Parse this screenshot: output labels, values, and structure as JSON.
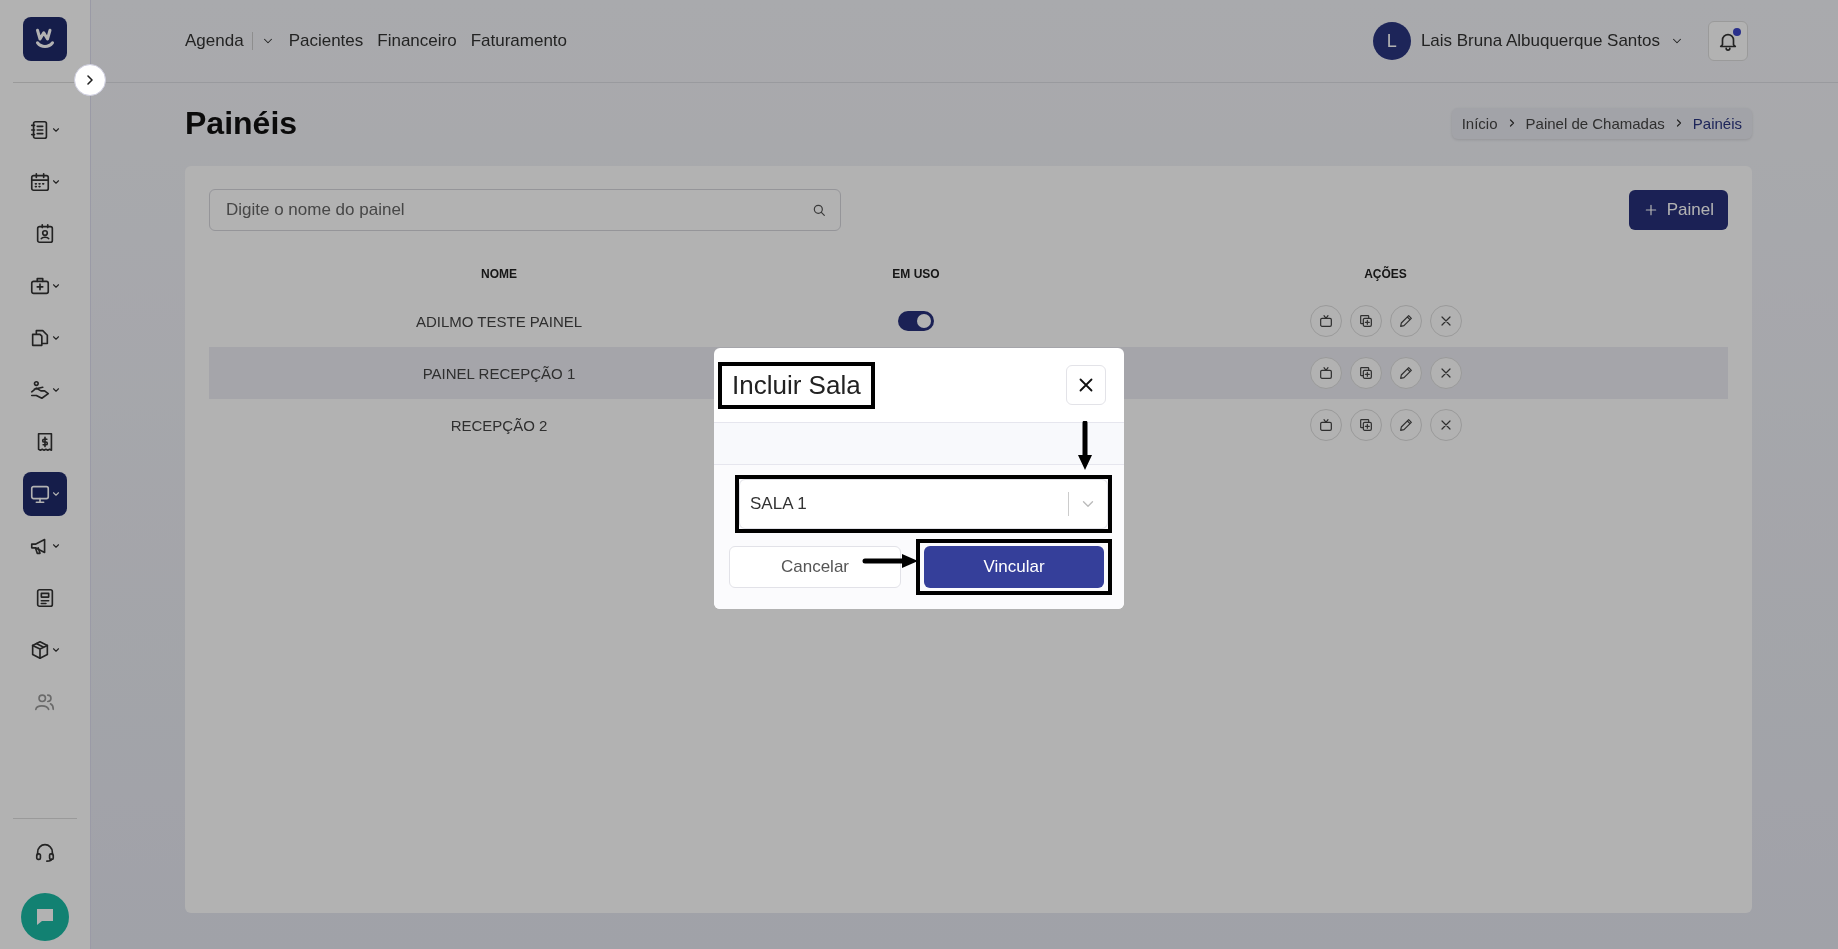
{
  "sidebar": {
    "items": [
      {
        "expandable": true,
        "selected": false,
        "disabled": false
      },
      {
        "expandable": true,
        "selected": false,
        "disabled": false
      },
      {
        "expandable": false,
        "selected": false,
        "disabled": false
      },
      {
        "expandable": true,
        "selected": false,
        "disabled": false
      },
      {
        "expandable": true,
        "selected": false,
        "disabled": false
      },
      {
        "expandable": true,
        "selected": false,
        "disabled": false
      },
      {
        "expandable": false,
        "selected": false,
        "disabled": false
      },
      {
        "expandable": true,
        "selected": true,
        "disabled": false
      },
      {
        "expandable": true,
        "selected": false,
        "disabled": false
      },
      {
        "expandable": false,
        "selected": false,
        "disabled": false
      },
      {
        "expandable": true,
        "selected": false,
        "disabled": false
      },
      {
        "expandable": false,
        "selected": false,
        "disabled": true
      }
    ]
  },
  "nav": {
    "items": [
      {
        "label": "Agenda",
        "has_menu": true
      },
      {
        "label": "Pacientes",
        "has_menu": false
      },
      {
        "label": "Financeiro",
        "has_menu": false
      },
      {
        "label": "Faturamento",
        "has_menu": false
      }
    ]
  },
  "user": {
    "initial": "L",
    "name": "Lais Bruna Albuquerque Santos",
    "unread_notifications": true
  },
  "page": {
    "title": "Painéis",
    "breadcrumb": [
      {
        "label": "Início",
        "current": false
      },
      {
        "label": "Painel de Chamadas",
        "current": false
      },
      {
        "label": "Painéis",
        "current": true
      }
    ]
  },
  "search": {
    "placeholder": "Digite o nome do painel"
  },
  "add_button": {
    "label": "Painel"
  },
  "table": {
    "columns": [
      "NOME",
      "EM USO",
      "AÇÕES"
    ],
    "rows": [
      {
        "name": "ADILMO TESTE PAINEL",
        "in_use": true,
        "selected": false
      },
      {
        "name": "PAINEL RECEPÇÃO 1",
        "selected": true
      },
      {
        "name": "RECEPÇÃO 2",
        "selected": false
      }
    ]
  },
  "modal": {
    "title": {
      "text": "Incluir Sala",
      "highlighted": true
    },
    "select": {
      "value": "SALA 1",
      "highlighted": true,
      "pointed_at": true
    },
    "buttons": [
      {
        "label": "Cancelar",
        "kind": "secondary",
        "highlighted": false
      },
      {
        "label": "Vincular",
        "kind": "primary",
        "highlighted": true,
        "pointed_at": true
      }
    ]
  }
}
